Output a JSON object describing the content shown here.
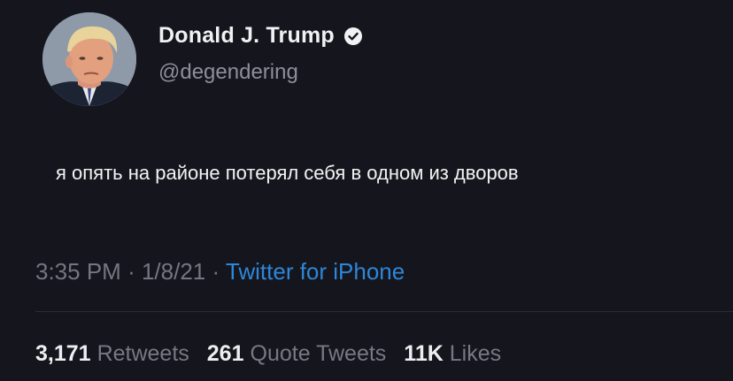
{
  "author": {
    "display_name": "Donald J. Trump",
    "handle": "@degendering",
    "verified_icon": "verified-badge-icon",
    "avatar_icon": "avatar-portrait"
  },
  "tweet": {
    "text": "я опять на районе потерял себя в одном из дворов"
  },
  "meta": {
    "time": "3:35 PM",
    "separator_1": "·",
    "date": "1/8/21",
    "separator_2": "·",
    "source": "Twitter for iPhone"
  },
  "stats": {
    "retweets_count": "3,171",
    "retweets_label": "Retweets",
    "quotes_count": "261",
    "quotes_label": "Quote Tweets",
    "likes_count": "11K",
    "likes_label": "Likes"
  },
  "colors": {
    "background": "#15161d",
    "link": "#2e86d8",
    "muted": "#767982"
  }
}
